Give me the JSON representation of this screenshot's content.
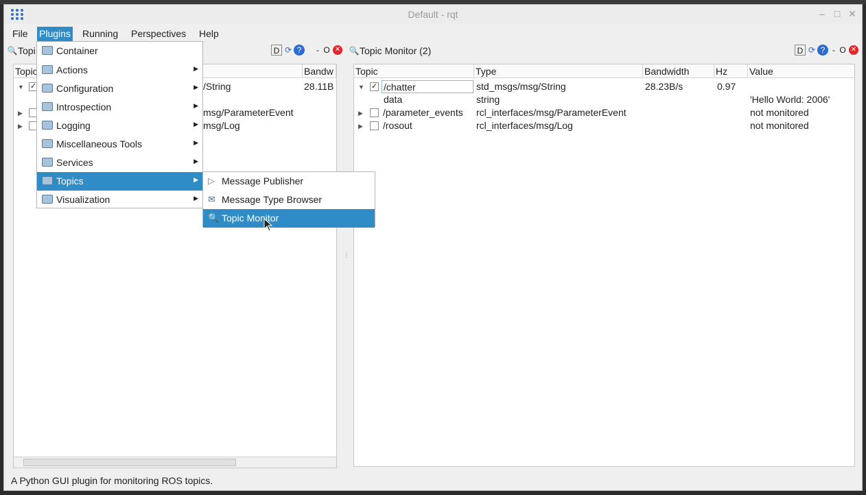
{
  "window": {
    "title": "Default - rqt"
  },
  "menubar": {
    "file": "File",
    "plugins": "Plugins",
    "running": "Running",
    "perspectives": "Perspectives",
    "help": "Help"
  },
  "left_panel": {
    "title": "Topi",
    "header": {
      "topic": "Topic",
      "type": "",
      "bandwidth": "Bandw"
    },
    "rows": [
      {
        "type": "/String",
        "bandwidth": "28.11B"
      },
      {
        "type": "msg/ParameterEvent"
      },
      {
        "type": "msg/Log"
      }
    ]
  },
  "right_panel": {
    "title": "Topic Monitor (2)",
    "header": {
      "topic": "Topic",
      "type": "Type",
      "bandwidth": "Bandwidth",
      "hz": "Hz",
      "value": "Value"
    },
    "rows": [
      {
        "topic": "/chatter",
        "type": "std_msgs/msg/String",
        "bandwidth": "28.23B/s",
        "hz": "0.97",
        "value": "",
        "checked": true
      },
      {
        "topic": "data",
        "type": "string",
        "value": "'Hello World: 2006'"
      },
      {
        "topic": "/parameter_events",
        "type": "rcl_interfaces/msg/ParameterEvent",
        "value": "not monitored",
        "checked": false
      },
      {
        "topic": "/rosout",
        "type": "rcl_interfaces/msg/Log",
        "value": "not monitored",
        "checked": false
      }
    ]
  },
  "panel_buttons": {
    "d": "D",
    "o": "O",
    "dash": "-"
  },
  "plugins_menu": {
    "items": [
      {
        "label": "Container"
      },
      {
        "label": "Actions"
      },
      {
        "label": "Configuration"
      },
      {
        "label": "Introspection"
      },
      {
        "label": "Logging"
      },
      {
        "label": "Miscellaneous Tools"
      },
      {
        "label": "Services"
      },
      {
        "label": "Topics"
      },
      {
        "label": "Visualization"
      }
    ]
  },
  "topics_submenu": {
    "items": [
      {
        "label": "Message Publisher"
      },
      {
        "label": "Message Type Browser"
      },
      {
        "label": "Topic Monitor"
      }
    ]
  },
  "statusbar": {
    "text": "A Python GUI plugin for monitoring ROS topics."
  },
  "colors": {
    "selection": "#308cc6",
    "close": "#e3262a"
  }
}
